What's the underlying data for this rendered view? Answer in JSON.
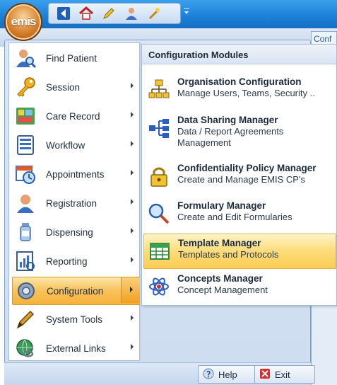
{
  "app": {
    "orb_label": "emis"
  },
  "background": {
    "tab_label": "Conf"
  },
  "menu": {
    "items": [
      {
        "label": "Find Patient",
        "icon": "user-search-icon",
        "has_submenu": false
      },
      {
        "label": "Session",
        "icon": "key-icon",
        "has_submenu": true
      },
      {
        "label": "Care Record",
        "icon": "care-record-icon",
        "has_submenu": true
      },
      {
        "label": "Workflow",
        "icon": "workflow-icon",
        "has_submenu": true
      },
      {
        "label": "Appointments",
        "icon": "calendar-clock-icon",
        "has_submenu": true
      },
      {
        "label": "Registration",
        "icon": "person-icon",
        "has_submenu": true
      },
      {
        "label": "Dispensing",
        "icon": "bottle-icon",
        "has_submenu": true
      },
      {
        "label": "Reporting",
        "icon": "report-icon",
        "has_submenu": true
      },
      {
        "label": "Configuration",
        "icon": "gear-icon",
        "has_submenu": true,
        "selected": true
      },
      {
        "label": "System Tools",
        "icon": "pen-icon",
        "has_submenu": true
      },
      {
        "label": "External Links",
        "icon": "globe-link-icon",
        "has_submenu": true
      }
    ]
  },
  "submenu": {
    "header": "Configuration Modules",
    "items": [
      {
        "title": "Organisation Configuration",
        "desc": "Manage Users, Teams, Security ..",
        "icon": "org-chart-icon"
      },
      {
        "title": "Data Sharing Manager",
        "desc": "Data / Report Agreements Management",
        "icon": "share-network-icon"
      },
      {
        "title": "Confidentiality Policy Manager",
        "desc": "Create and Manage EMIS CP's",
        "icon": "padlock-icon"
      },
      {
        "title": "Formulary Manager",
        "desc": "Create and Edit Formularies",
        "icon": "magnifier-icon"
      },
      {
        "title": "Template Manager",
        "desc": "Templates and Protocols",
        "icon": "grid-table-icon",
        "selected": true
      },
      {
        "title": "Concepts Manager",
        "desc": "Concept Management",
        "icon": "atom-icon"
      }
    ]
  },
  "footer": {
    "help_label": "Help",
    "exit_label": "Exit"
  },
  "colors": {
    "highlight": "#f8c25a",
    "titlebar": "#1b7fd6",
    "menu_border": "#7e9ec8"
  }
}
